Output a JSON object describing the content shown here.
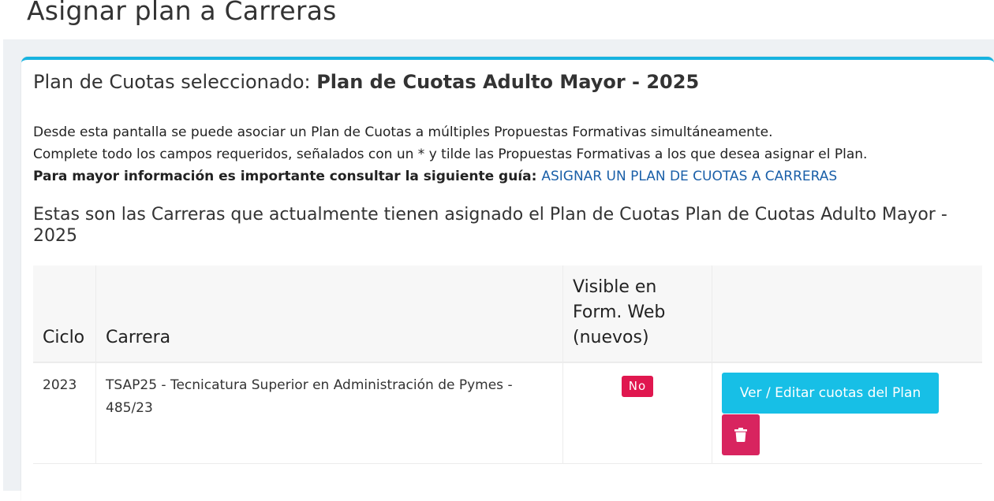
{
  "page": {
    "title": "Asignar plan a Carreras"
  },
  "card": {
    "heading_prefix": "Plan de Cuotas seleccionado: ",
    "plan_name": "Plan de Cuotas Adulto Mayor - 2025",
    "intro_line1": "Desde esta pantalla se puede asociar un Plan de Cuotas a múltiples Propuestas Formativas simultáneamente.",
    "intro_line2": "Complete todo los campos requeridos, señalados con un * y tilde las Propuestas Formativas a los que desea asignar el Plan.",
    "intro_line3_bold": "Para mayor información es importante consultar la siguiente guía: ",
    "guide_link": "ASIGNAR UN PLAN DE CUOTAS A CARRERAS",
    "section_heading": "Estas son las Carreras que actualmente tienen asignado el Plan de Cuotas Plan de Cuotas Adulto Mayor - 2025"
  },
  "table": {
    "headers": {
      "ciclo": "Ciclo",
      "carrera": "Carrera",
      "visible": "Visible en Form. Web (nuevos)",
      "actions": ""
    },
    "rows": [
      {
        "ciclo": "2023",
        "carrera": "TSAP25 - Tecnicatura Superior en Administración de Pymes - 485/23",
        "visible": "No",
        "edit_label": "Ver / Editar cuotas del Plan",
        "delete_icon": "trash-icon"
      }
    ]
  },
  "colors": {
    "accent": "#17b3e0",
    "edit_button": "#17bfe6",
    "delete_button": "#d8245f",
    "badge_no": "#e0174f",
    "link": "#1a5fa8"
  }
}
